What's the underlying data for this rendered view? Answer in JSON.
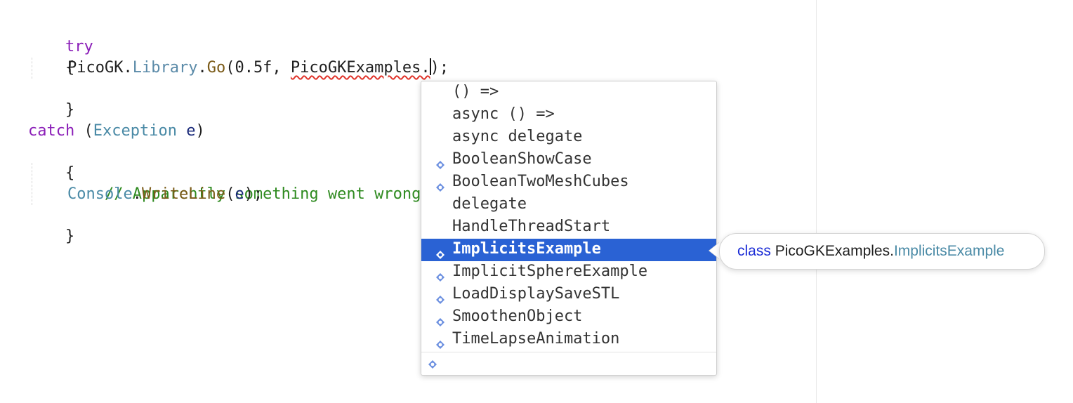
{
  "colors": {
    "keyword": "#8b1fb8",
    "type": "#4a8aa6",
    "method": "#7a5a17",
    "comment": "#2e8a1f",
    "selection": "#2a62d4",
    "error_squiggle": "#e0342b"
  },
  "code": {
    "line1": {
      "keyword": "try"
    },
    "line2": {
      "brace": "{"
    },
    "line3": {
      "obj": "PicoGK",
      "dot1": ".",
      "member": "Library",
      "dot2": ".",
      "method": "Go",
      "args_start": "(0.5f, ",
      "arg_error": "PicoGKExamples.",
      "args_end": ");"
    },
    "line4": {
      "brace": "}"
    },
    "line6": {
      "keyword": "catch",
      "paren_open": " (",
      "type": "Exception",
      "space": " ",
      "param": "e",
      "paren_close": ")"
    },
    "line7": {
      "brace": "{"
    },
    "line8": {
      "comment": "// Apparently something went wrong, output here"
    },
    "line9": {
      "obj": "Console",
      "dot": ".",
      "method": "WriteLine",
      "open": "(",
      "param": "e",
      "close": ");"
    },
    "line10": {
      "brace": "}"
    }
  },
  "completion": {
    "items": [
      {
        "label": "() =>",
        "icon": "none"
      },
      {
        "label": "async () =>",
        "icon": "none"
      },
      {
        "label": "async delegate",
        "icon": "none"
      },
      {
        "label": "BooleanShowCase",
        "icon": "class-icon"
      },
      {
        "label": "BooleanTwoMeshCubes",
        "icon": "class-icon"
      },
      {
        "label": "delegate",
        "icon": "none"
      },
      {
        "label": "HandleThreadStart",
        "icon": "none"
      },
      {
        "label": "ImplicitsExample",
        "icon": "class-icon",
        "selected": true
      },
      {
        "label": "ImplicitSphereExample",
        "icon": "class-icon"
      },
      {
        "label": "LoadDisplaySaveSTL",
        "icon": "class-icon"
      },
      {
        "label": "SmoothenObject",
        "icon": "class-icon"
      },
      {
        "label": "TimeLapseAnimation",
        "icon": "class-icon"
      }
    ],
    "footer_icon": "class-filter-icon"
  },
  "tooltip": {
    "keyword": "class",
    "namespace": " PicoGKExamples.",
    "type": "ImplicitsExample"
  }
}
